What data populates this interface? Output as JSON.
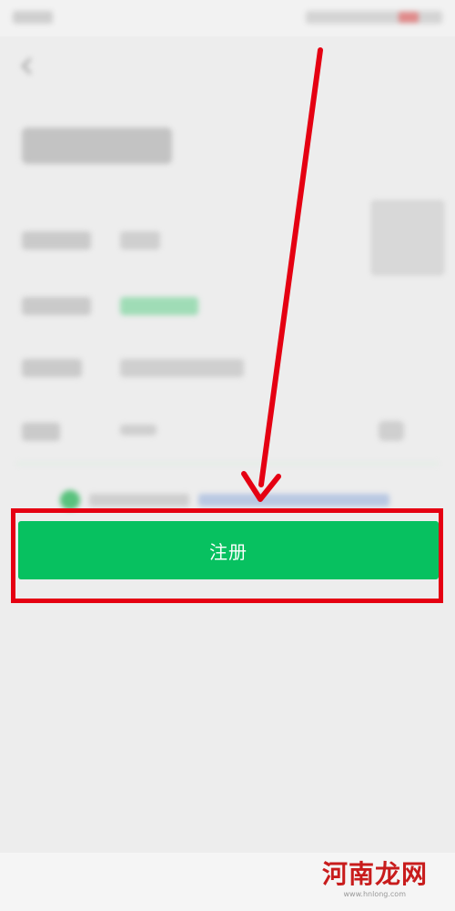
{
  "register_button": {
    "label": "注册"
  },
  "colors": {
    "primary_green": "#07c160",
    "highlight_red": "#e50012",
    "background": "#ededed"
  },
  "icons": {
    "back": "back-arrow-icon",
    "agree": "checkbox-icon",
    "password_toggle": "eye-icon"
  },
  "watermark": {
    "text": "河南龙网",
    "subtext": "www.hnlong.com"
  }
}
